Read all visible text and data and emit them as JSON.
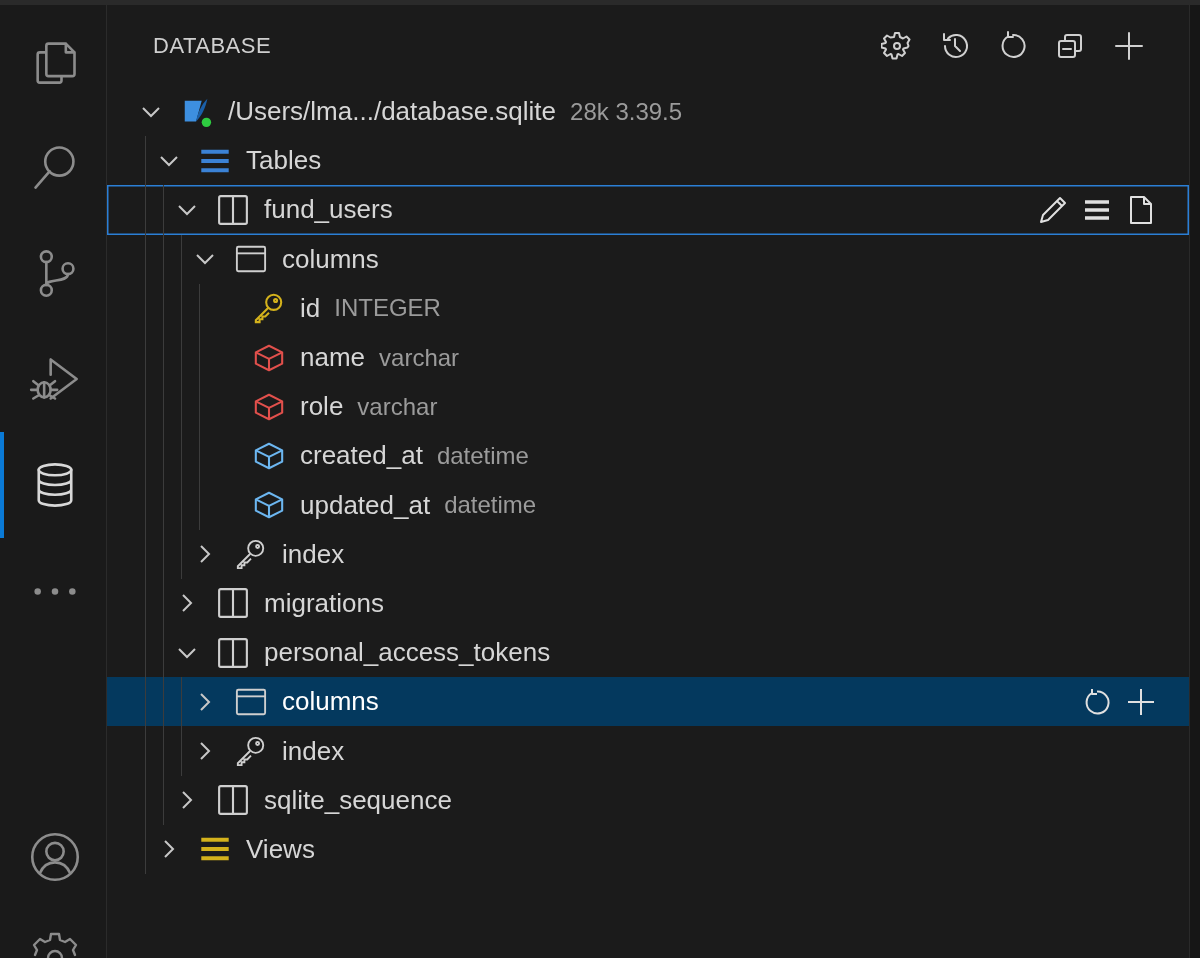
{
  "activity_bar": [
    {
      "kind": "explorer",
      "selected": false
    },
    {
      "kind": "search",
      "selected": false
    },
    {
      "kind": "source_control",
      "selected": false
    },
    {
      "kind": "run_debug",
      "selected": false
    },
    {
      "kind": "database",
      "selected": true
    },
    {
      "kind": "more",
      "selected": false
    },
    {
      "kind": "account",
      "selected": false
    },
    {
      "kind": "manage",
      "selected": false
    }
  ],
  "panel": {
    "title": "DATABASE"
  },
  "tree": [
    {
      "kind": "connection",
      "label": "/Users/lma.../database.sqlite",
      "meta": "28k 3.39.5",
      "connected": true,
      "expanded": true,
      "selected": false,
      "focused": false,
      "children": [
        {
          "kind": "group",
          "label": "Tables",
          "color": "#3b82d6",
          "expanded": true,
          "selected": false,
          "focused": false,
          "children": [
            {
              "kind": "table",
              "label": "fund_users",
              "expanded": true,
              "selected": false,
              "focused": true,
              "children": [
                {
                  "kind": "columns",
                  "label": "columns",
                  "expanded": true,
                  "selected": false,
                  "focused": false,
                  "children": [
                    {
                      "kind": "primary_key",
                      "label": "id",
                      "type": "INTEGER",
                      "color": "#d4b21c",
                      "selected": false,
                      "focused": false
                    },
                    {
                      "kind": "field",
                      "label": "name",
                      "type": "varchar",
                      "color": "#e2504c",
                      "selected": false,
                      "focused": false
                    },
                    {
                      "kind": "field",
                      "label": "role",
                      "type": "varchar",
                      "color": "#e2504c",
                      "selected": false,
                      "focused": false
                    },
                    {
                      "kind": "field",
                      "label": "created_at",
                      "type": "datetime",
                      "color": "#6cb6f0",
                      "selected": false,
                      "focused": false
                    },
                    {
                      "kind": "field",
                      "label": "updated_at",
                      "type": "datetime",
                      "color": "#6cb6f0",
                      "selected": false,
                      "focused": false
                    }
                  ]
                },
                {
                  "kind": "index",
                  "label": "index",
                  "expanded": false,
                  "selected": false,
                  "focused": false
                }
              ]
            },
            {
              "kind": "table",
              "label": "migrations",
              "expanded": false,
              "selected": false,
              "focused": false
            },
            {
              "kind": "table",
              "label": "personal_access_tokens",
              "expanded": true,
              "selected": false,
              "focused": false,
              "children": [
                {
                  "kind": "columns",
                  "label": "columns",
                  "expanded": false,
                  "selected": true,
                  "focused": false
                },
                {
                  "kind": "index",
                  "label": "index",
                  "expanded": false,
                  "selected": false,
                  "focused": false
                }
              ]
            },
            {
              "kind": "table",
              "label": "sqlite_sequence",
              "expanded": false,
              "selected": false,
              "focused": false
            }
          ]
        },
        {
          "kind": "group",
          "label": "Views",
          "color": "#d4b21c",
          "expanded": false,
          "selected": false,
          "focused": false
        }
      ]
    }
  ]
}
